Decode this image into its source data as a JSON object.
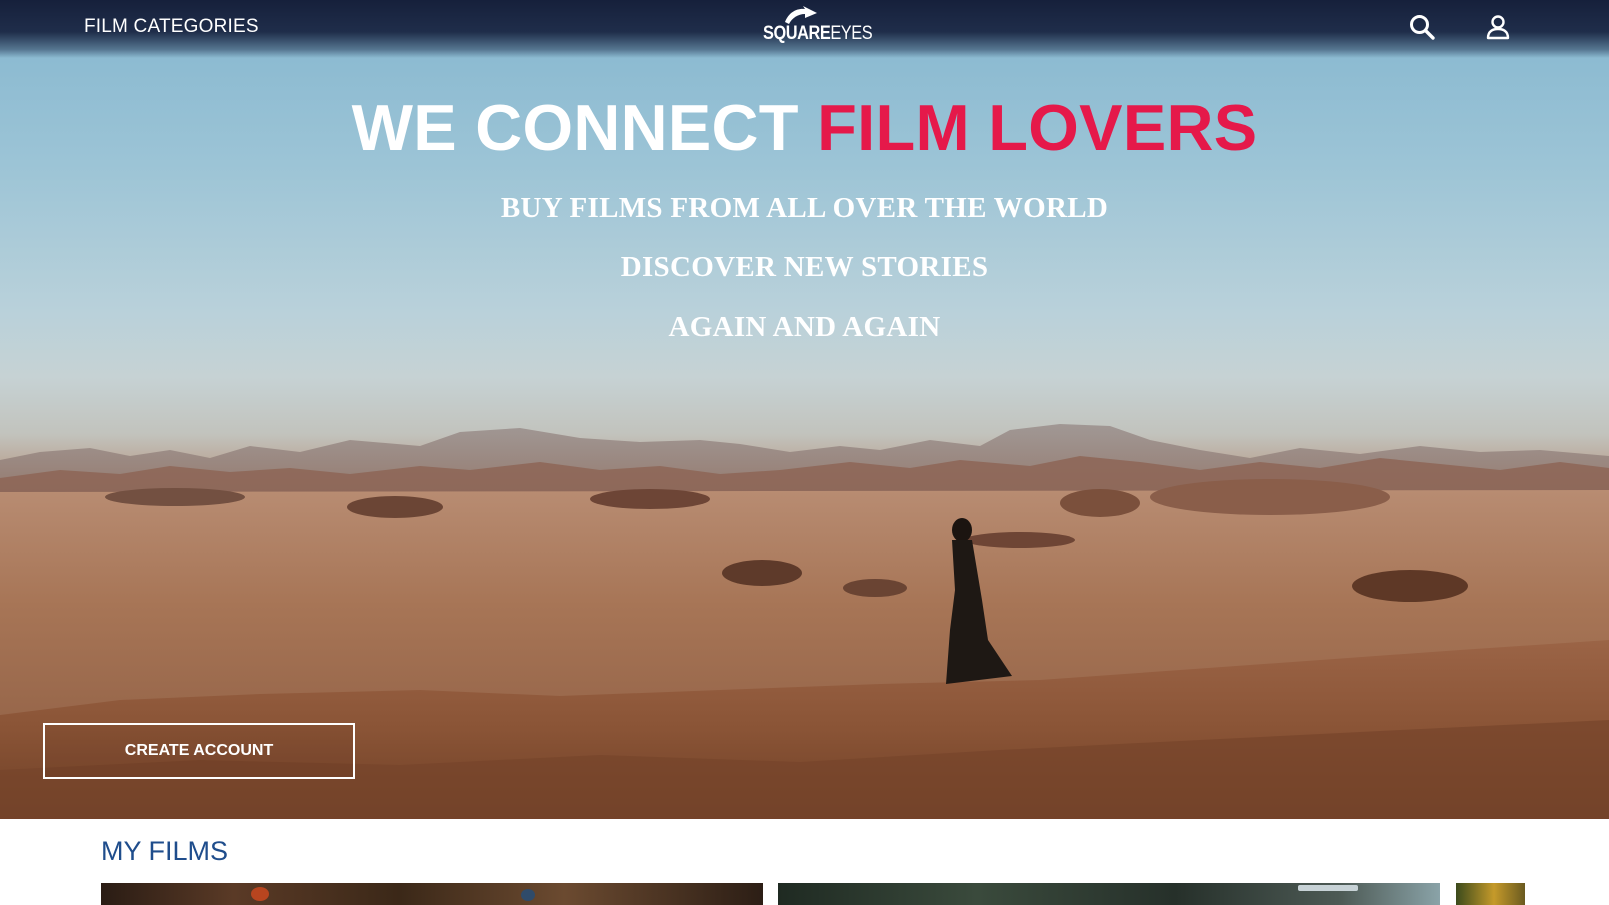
{
  "nav": {
    "categories_label": "FILM CATEGORIES",
    "logo_square": "SQUARE",
    "logo_eyes": "EYES"
  },
  "hero": {
    "headline_white": "WE CONNECT",
    "headline_accent": "FILM LOVERS",
    "taglines": [
      "BUY FILMS FROM ALL OVER THE WORLD",
      "DISCOVER NEW STORIES",
      "AGAIN AND AGAIN"
    ],
    "cta_label": "CREATE ACCOUNT"
  },
  "my_films": {
    "title": "MY FILMS",
    "cards": [
      {
        "name": "film-card-1"
      },
      {
        "name": "film-card-2"
      },
      {
        "name": "film-card-3"
      }
    ]
  },
  "icons": {
    "search": "search-icon",
    "account": "user-icon"
  },
  "colors": {
    "accent": "#e5194a",
    "section_title": "#1f4d8c",
    "nav_bg": "#16203b",
    "text_light": "#ffffff"
  }
}
